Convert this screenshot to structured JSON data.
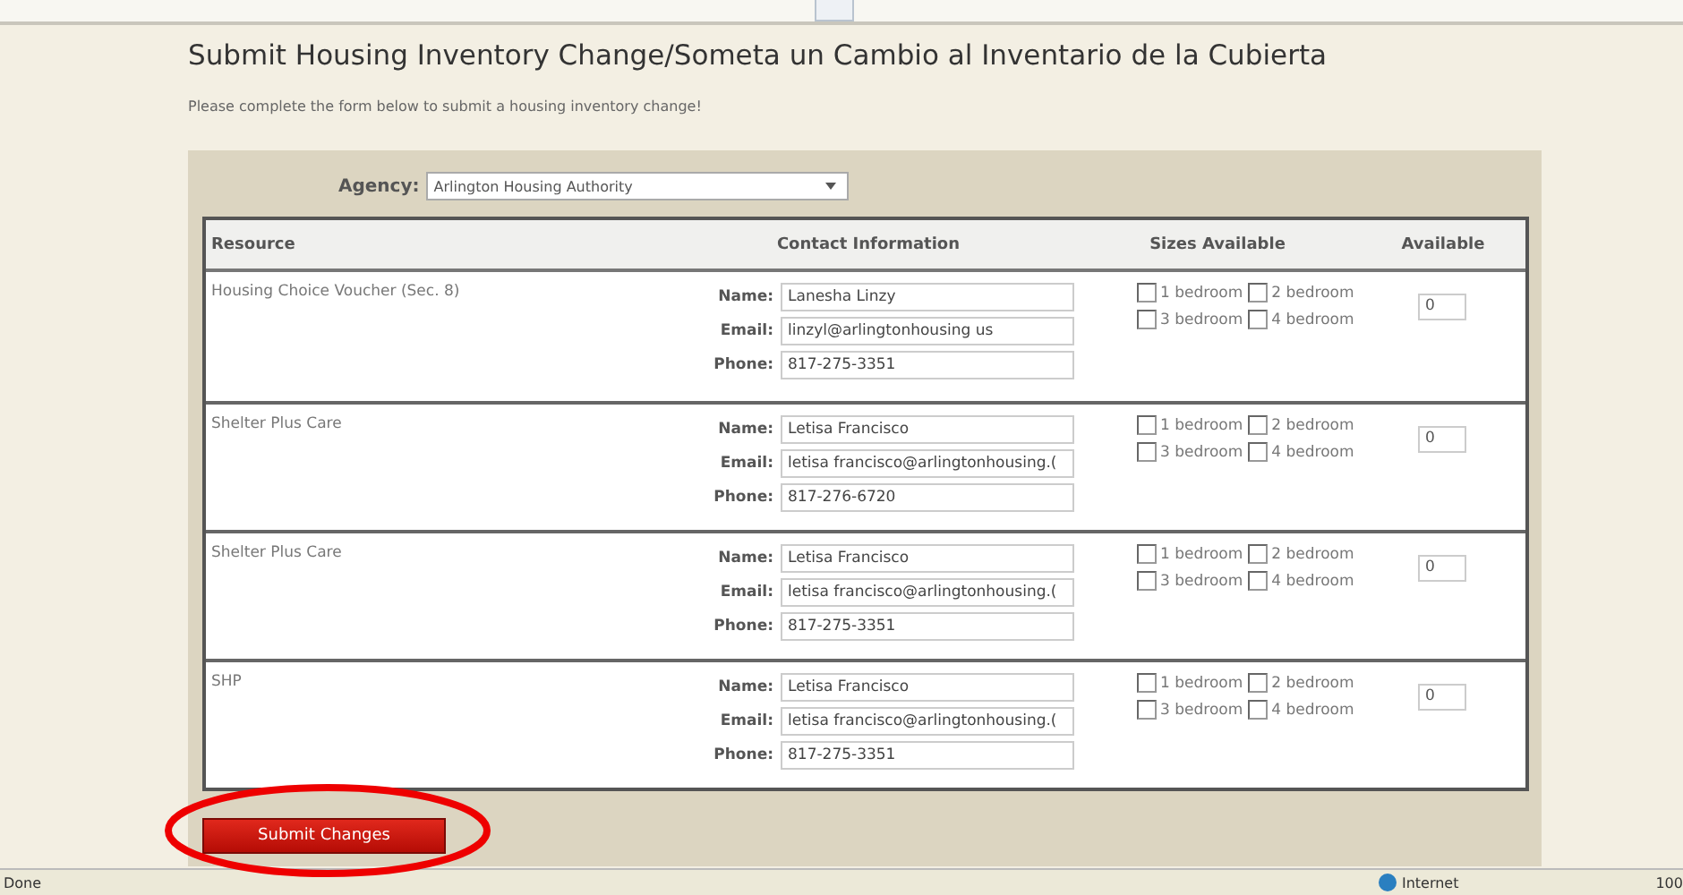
{
  "title": "Submit Housing Inventory Change/Someta un Cambio al Inventario de la Cubierta",
  "intro": "Please complete the form below to submit a housing inventory change!",
  "agency": {
    "label": "Agency:",
    "value": "Arlington Housing Authority"
  },
  "table": {
    "columns": [
      "Resource",
      "Contact Information",
      "Sizes Available",
      "Available"
    ],
    "rows": [
      {
        "resource": "Housing Choice Voucher (Sec. 8)",
        "contact": [
          {
            "label": "Name:",
            "value": "Lanesha Linzy"
          },
          {
            "label": "Email:",
            "value": "linzyl@arlingtonhousing us"
          },
          {
            "label": "Phone:",
            "value": "817-275-3351"
          }
        ],
        "sizes": [
          {
            "label": "1 bedroom",
            "checked": false
          },
          {
            "label": "2 bedroom",
            "checked": false
          },
          {
            "label": "3 bedroom",
            "checked": false
          },
          {
            "label": "4 bedroom",
            "checked": false
          }
        ],
        "available": "0"
      },
      {
        "resource": "Shelter Plus Care",
        "contact": [
          {
            "label": "Name:",
            "value": "Letisa Francisco"
          },
          {
            "label": "Email:",
            "value": "letisa francisco@arlingtonhousing.("
          },
          {
            "label": "Phone:",
            "value": "817-276-6720"
          }
        ],
        "sizes": [
          {
            "label": "1 bedroom",
            "checked": false
          },
          {
            "label": "2 bedroom",
            "checked": false
          },
          {
            "label": "3 bedroom",
            "checked": false
          },
          {
            "label": "4 bedroom",
            "checked": false
          }
        ],
        "available": "0"
      },
      {
        "resource": "Shelter Plus Care",
        "contact": [
          {
            "label": "Name:",
            "value": "Letisa Francisco"
          },
          {
            "label": "Email:",
            "value": "letisa francisco@arlingtonhousing.("
          },
          {
            "label": "Phone:",
            "value": "817-275-3351"
          }
        ],
        "sizes": [
          {
            "label": "1 bedroom",
            "checked": false
          },
          {
            "label": "2 bedroom",
            "checked": false
          },
          {
            "label": "3 bedroom",
            "checked": false
          },
          {
            "label": "4 bedroom",
            "checked": false
          }
        ],
        "available": "0"
      },
      {
        "resource": "SHP",
        "contact": [
          {
            "label": "Name:",
            "value": "Letisa Francisco"
          },
          {
            "label": "Email:",
            "value": "letisa francisco@arlingtonhousing.("
          },
          {
            "label": "Phone:",
            "value": "817-275-3351"
          }
        ],
        "sizes": [
          {
            "label": "1 bedroom",
            "checked": false
          },
          {
            "label": "2 bedroom",
            "checked": false
          },
          {
            "label": "3 bedroom",
            "checked": false
          },
          {
            "label": "4 bedroom",
            "checked": false
          }
        ],
        "available": "0"
      }
    ]
  },
  "submit_button": "Submit Changes",
  "status_bar": {
    "status": "Done",
    "zone": "Internet",
    "zoom": "100"
  }
}
